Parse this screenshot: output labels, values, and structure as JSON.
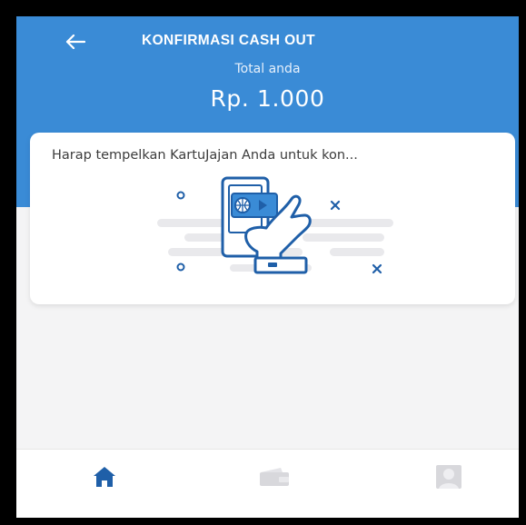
{
  "header": {
    "title": "KONFIRMASI CASH OUT",
    "total_label": "Total anda",
    "total_amount": "Rp. 1.000",
    "back_icon": "arrow-left-icon"
  },
  "card": {
    "message": "Harap tempelkan KartuJajan Anda untuk kon..."
  },
  "bottom_nav": {
    "items": [
      {
        "icon": "home-icon",
        "active": true
      },
      {
        "icon": "wallet-icon",
        "active": false
      },
      {
        "icon": "profile-icon",
        "active": false
      }
    ]
  },
  "colors": {
    "primary": "#3a8bd6",
    "illustration_blue": "#1f5fa8",
    "inactive_icon": "#d8d8dc",
    "background": "#f4f4f5"
  }
}
